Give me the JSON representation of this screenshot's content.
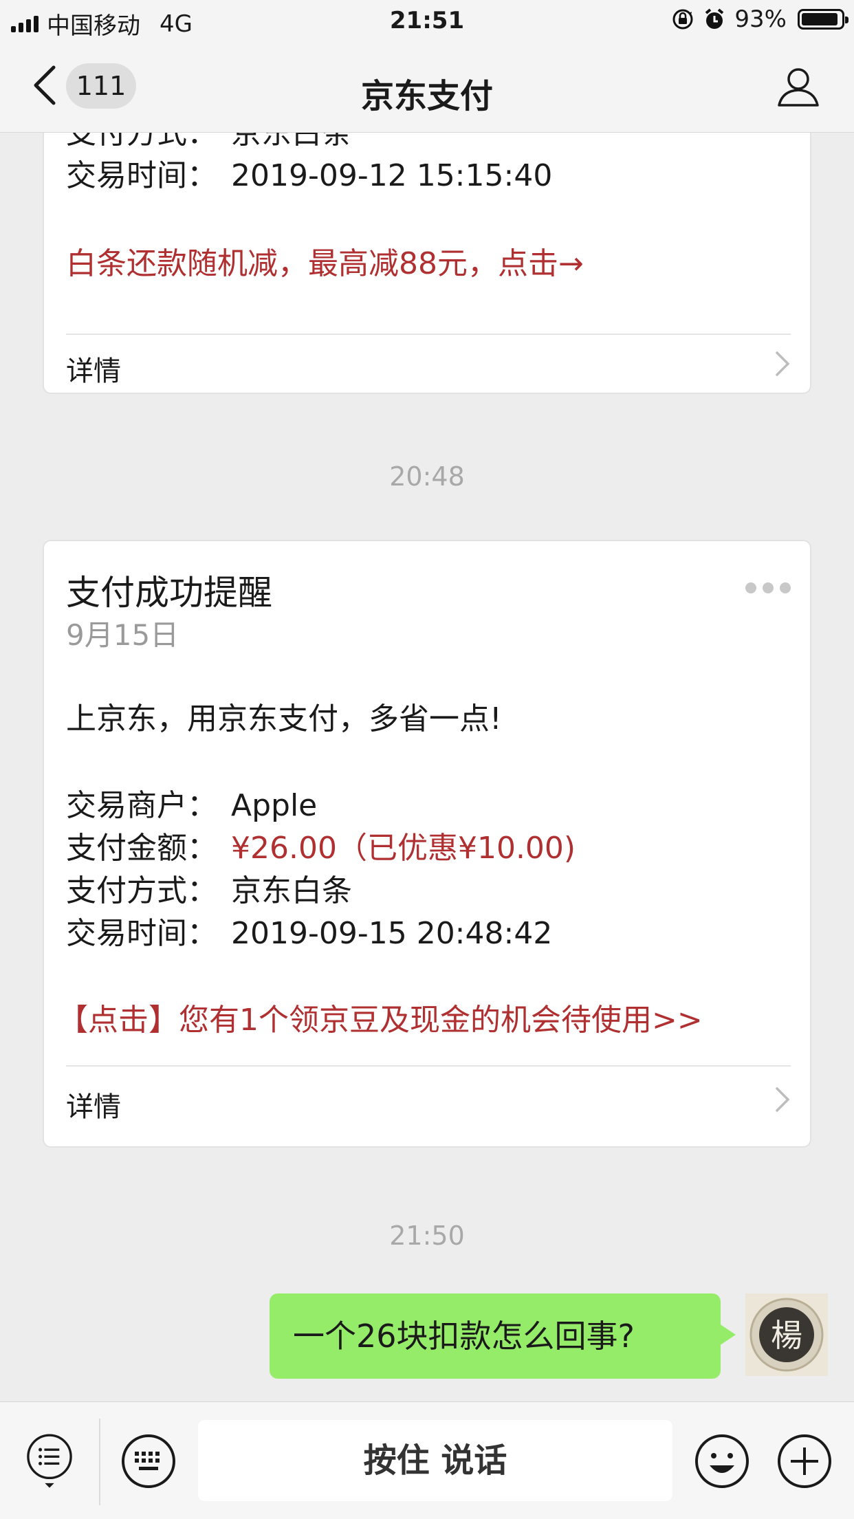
{
  "status_bar": {
    "carrier": "中国移动",
    "network": "4G",
    "time": "21:51",
    "battery_percent": "93%",
    "battery_level": 0.93,
    "icons": [
      "signal-icon",
      "rotation-lock-icon",
      "alarm-icon",
      "battery-icon"
    ]
  },
  "nav": {
    "back_icon": "chevron-left-icon",
    "unread_count": "111",
    "title": "京东支付",
    "profile_icon": "person-icon"
  },
  "messages": {
    "card1": {
      "partial_method_label": "支付方式：",
      "partial_method_value": "京东白条",
      "time_label": "交易时间：",
      "time_value": "2019-09-12 15:15:40",
      "promo": "白条还款随机减，最高减88元，点击→",
      "detail": "详情"
    },
    "timestamp1": "20:48",
    "card2": {
      "title": "支付成功提醒",
      "date": "9月15日",
      "slogan": "上京东，用京东支付，多省一点!",
      "merchant_label": "交易商户：",
      "merchant_value": "Apple",
      "amount_label": "支付金额：",
      "amount_value": "¥26.00（已优惠¥10.00)",
      "method_label": "支付方式：",
      "method_value": "京东白条",
      "time_label": "交易时间：",
      "time_value": "2019-09-15 20:48:42",
      "promo": "【点击】您有1个领京豆及现金的机会待使用>>",
      "detail": "详情",
      "more_icon": "more-dots-icon"
    },
    "timestamp2": "21:50",
    "user_message": "一个26块扣款怎么回事?",
    "avatar_char": "楊"
  },
  "toolbar": {
    "hold_to_talk": "按住 说话",
    "icons": [
      "menu-list-icon",
      "keyboard-icon",
      "emoji-icon",
      "plus-icon"
    ]
  },
  "colors": {
    "accent_red": "#b03032",
    "bubble_green": "#95ec69",
    "background": "#ededed"
  }
}
